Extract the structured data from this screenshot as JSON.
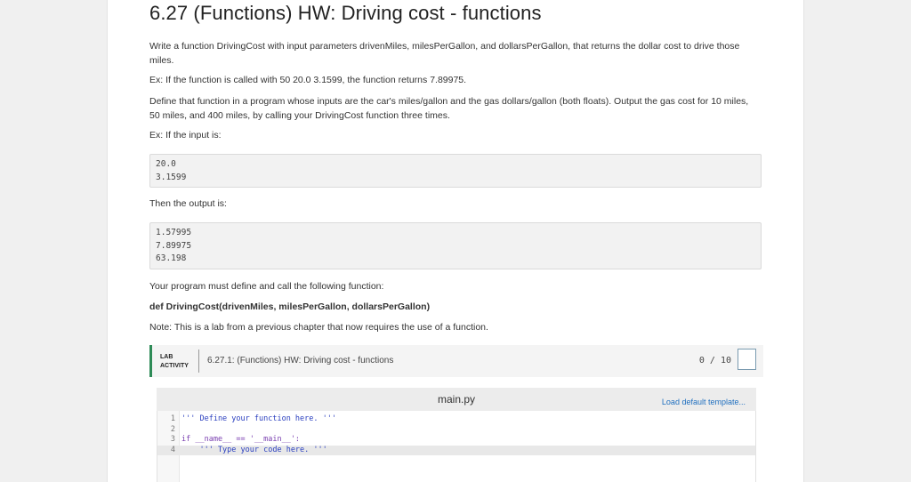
{
  "page": {
    "title": "6.27 (Functions) HW: Driving cost - functions",
    "intro": "Write a function DrivingCost with input parameters drivenMiles, milesPerGallon, and dollarsPerGallon, that returns the dollar cost to drive those miles.",
    "example1": "Ex: If the function is called with 50 20.0 3.1599, the function returns 7.89975.",
    "define": "Define that function in a program whose inputs are the car's miles/gallon and the gas dollars/gallon (both floats). Output the gas cost for 10 miles, 50 miles, and 400 miles, by calling your DrivingCost function three times.",
    "input_intro": "Ex: If the input is:",
    "input_lines": [
      "20.0",
      "3.1599"
    ],
    "output_intro": "Then the output is:",
    "output_lines": [
      "1.57995",
      "7.89975",
      "63.198"
    ],
    "must_define": "Your program must define and call the following function:",
    "signature": "def DrivingCost(drivenMiles, milesPerGallon, dollarsPerGallon)",
    "note": "Note: This is a lab from a previous chapter that now requires the use of a function."
  },
  "lab": {
    "tag_line1": "LAB",
    "tag_line2": "ACTIVITY",
    "title": "6.27.1: (Functions) HW: Driving cost - functions",
    "score": "0 / 10",
    "accent_color": "#2e8b57"
  },
  "editor": {
    "filename": "main.py",
    "load_template": "Load default template...",
    "lines": [
      {
        "num": "1",
        "text": "''' Define your function here. '''"
      },
      {
        "num": "2",
        "text": ""
      },
      {
        "num": "3",
        "text": "if __name__ == '__main__':"
      },
      {
        "num": "4",
        "text": "    ''' Type your code here. '''"
      }
    ]
  }
}
